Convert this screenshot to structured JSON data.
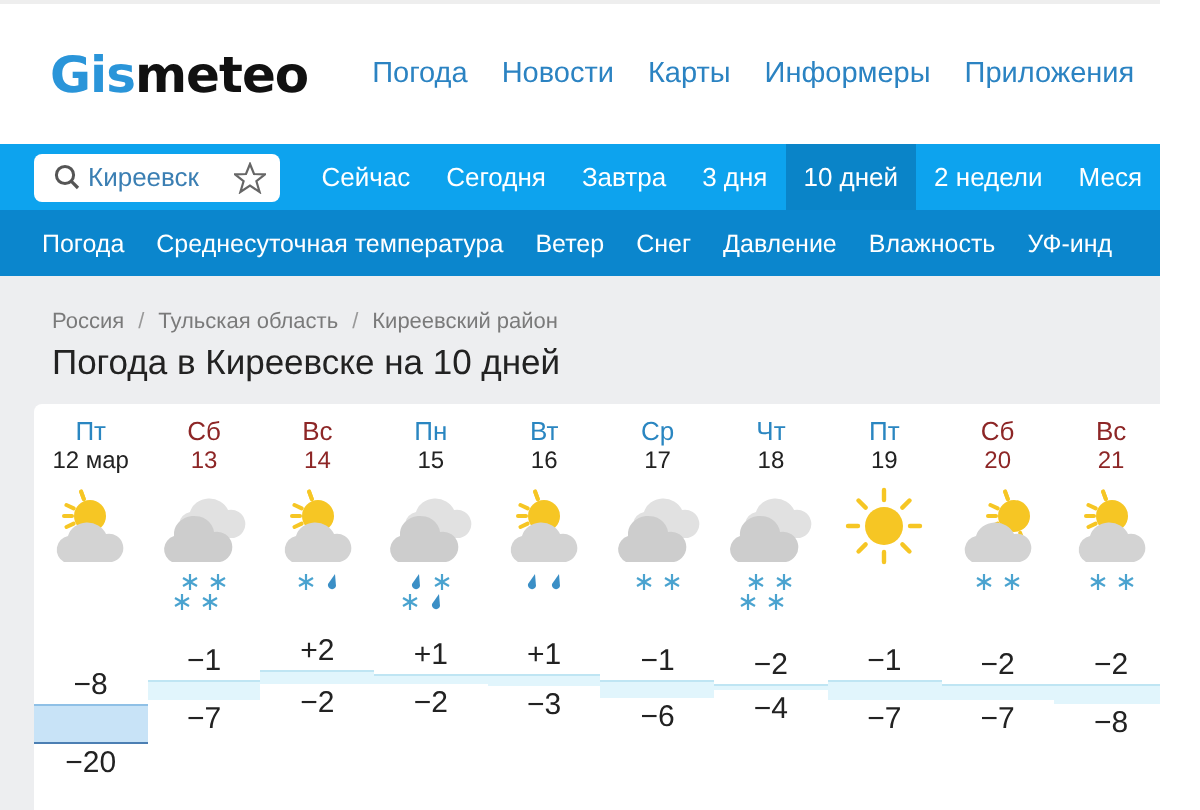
{
  "logo": {
    "accent": "Gis",
    "rest": "meteo"
  },
  "header_nav": [
    "Погода",
    "Новости",
    "Карты",
    "Информеры",
    "Приложения"
  ],
  "search": {
    "value": "Киреевск"
  },
  "tabs": [
    {
      "label": "Сейчас",
      "selected": false
    },
    {
      "label": "Сегодня",
      "selected": false
    },
    {
      "label": "Завтра",
      "selected": false
    },
    {
      "label": "3 дня",
      "selected": false
    },
    {
      "label": "10 дней",
      "selected": true
    },
    {
      "label": "2 недели",
      "selected": false
    },
    {
      "label": "Меся",
      "selected": false
    }
  ],
  "subnav": [
    "Погода",
    "Среднесуточная температура",
    "Ветер",
    "Снег",
    "Давление",
    "Влажность",
    "УФ-инд"
  ],
  "breadcrumbs": [
    "Россия",
    "/",
    "Тульская область",
    "/",
    "Киреевский район"
  ],
  "title": "Погода в Киреевске на 10 дней",
  "days": [
    {
      "weekday": "Пт",
      "date": "12 мар",
      "weekend": false,
      "sky": {
        "kind": "partly"
      },
      "max": "−8",
      "min": "−20"
    },
    {
      "weekday": "Сб",
      "date": "13",
      "weekend": true,
      "sky": {
        "kind": "cloudy"
      },
      "precip": [
        {
          "kind": "snow"
        },
        {
          "kind": "snow"
        },
        {
          "kind": "snow"
        },
        {
          "kind": "snow"
        }
      ],
      "max": "−1",
      "min": "−7"
    },
    {
      "weekday": "Вс",
      "date": "14",
      "weekend": true,
      "sky": {
        "kind": "partly"
      },
      "precip": [
        {
          "kind": "snow"
        },
        {
          "kind": "rain"
        }
      ],
      "max": "+2",
      "min": "−2"
    },
    {
      "weekday": "Пн",
      "date": "15",
      "weekend": false,
      "sky": {
        "kind": "cloudy"
      },
      "precip": [
        {
          "kind": "rain"
        },
        {
          "kind": "snow"
        },
        {
          "kind": "snow"
        },
        {
          "kind": "rain"
        }
      ],
      "max": "+1",
      "min": "−2"
    },
    {
      "weekday": "Вт",
      "date": "16",
      "weekend": false,
      "sky": {
        "kind": "partly"
      },
      "precip": [
        {
          "kind": "rain"
        },
        {
          "kind": "rain"
        }
      ],
      "max": "+1",
      "min": "−3"
    },
    {
      "weekday": "Ср",
      "date": "17",
      "weekend": false,
      "sky": {
        "kind": "cloudy"
      },
      "precip": [
        {
          "kind": "snow"
        },
        {
          "kind": "snow"
        }
      ],
      "max": "−1",
      "min": "−6"
    },
    {
      "weekday": "Чт",
      "date": "18",
      "weekend": false,
      "sky": {
        "kind": "cloudy"
      },
      "precip": [
        {
          "kind": "snow"
        },
        {
          "kind": "snow"
        },
        {
          "kind": "snow"
        },
        {
          "kind": "snow"
        }
      ],
      "max": "−2",
      "min": "−4"
    },
    {
      "weekday": "Пт",
      "date": "19",
      "weekend": false,
      "sky": {
        "kind": "sun"
      },
      "max": "−1",
      "min": "−7"
    },
    {
      "weekday": "Сб",
      "date": "20",
      "weekend": true,
      "sky": {
        "kind": "partly-side"
      },
      "precip": [
        {
          "kind": "snow"
        },
        {
          "kind": "snow"
        }
      ],
      "max": "−2",
      "min": "−7"
    },
    {
      "weekday": "Вс",
      "date": "21",
      "weekend": true,
      "sky": {
        "kind": "partly"
      },
      "precip": [
        {
          "kind": "snow"
        },
        {
          "kind": "snow"
        }
      ],
      "max": "−2",
      "min": "−8"
    }
  ]
}
